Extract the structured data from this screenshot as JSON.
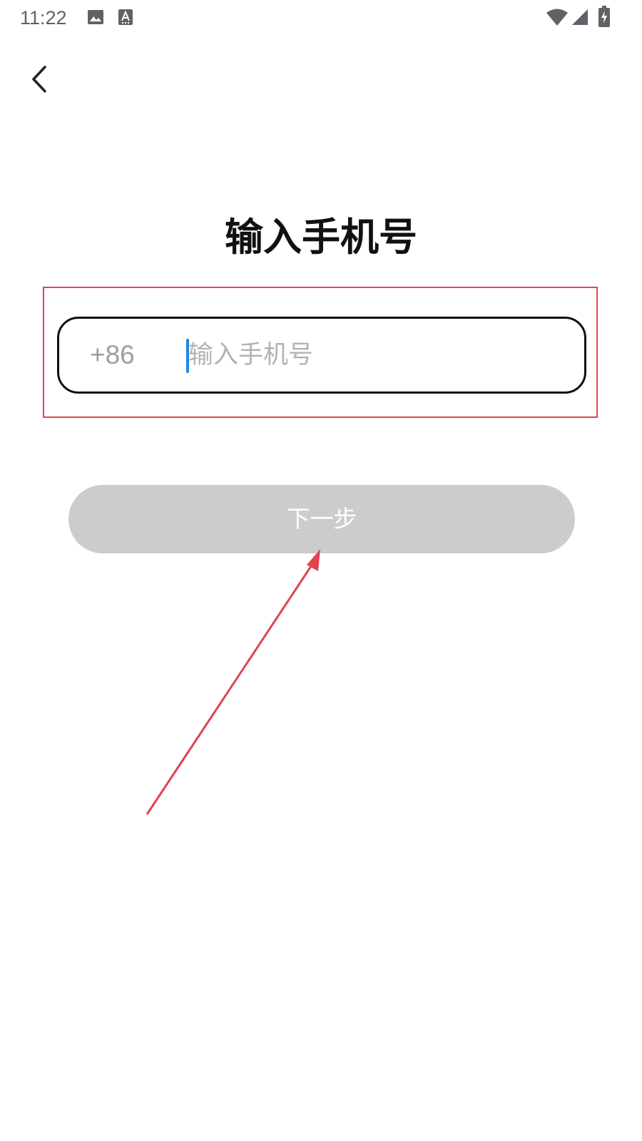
{
  "status_bar": {
    "time": "11:22",
    "icons": [
      "image-icon",
      "text-a-icon",
      "wifi-icon",
      "cell-signal-icon",
      "battery-charging-icon"
    ]
  },
  "header": {
    "back_icon": "chevron-left-icon"
  },
  "main": {
    "title": "输入手机号",
    "phone": {
      "country_code": "+86",
      "placeholder": "输入手机号",
      "value": ""
    },
    "next_label": "下一步"
  },
  "colors": {
    "annotation": "#e0454f",
    "button_disabled": "#cccccc",
    "cursor": "#1e88e5",
    "placeholder": "#b3b3b3"
  }
}
